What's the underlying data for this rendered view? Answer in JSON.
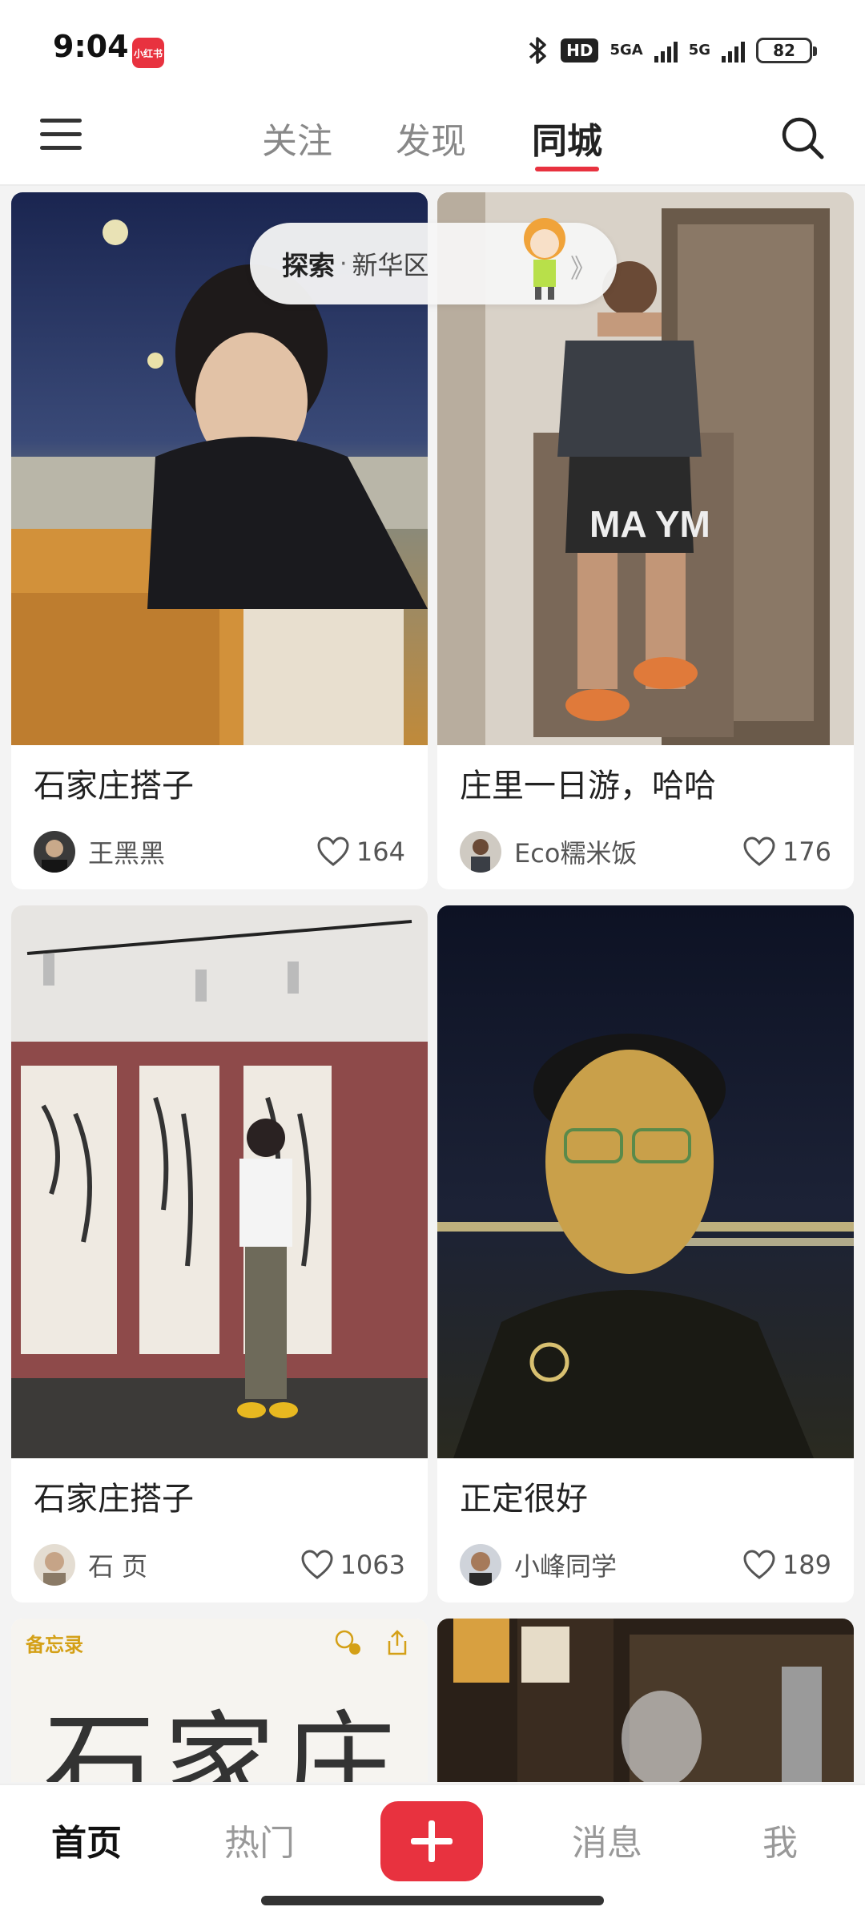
{
  "status_bar": {
    "time": "9:04",
    "app_icon_text": "小红书",
    "hd_label": "HD",
    "network_1": "5GA",
    "network_2": "5G",
    "battery": "82"
  },
  "top_nav": {
    "tabs": [
      {
        "label": "关注",
        "active": false
      },
      {
        "label": "发现",
        "active": false
      },
      {
        "label": "同城",
        "active": true
      }
    ]
  },
  "explore_pill": {
    "label": "探索",
    "dot": "·",
    "location": "新华区",
    "arrow": "》"
  },
  "feed": {
    "cards": [
      {
        "title": "石家庄搭子",
        "author": "王黑黑",
        "likes": "164"
      },
      {
        "title": "庄里一日游，哈哈",
        "author": "Eco糯米饭",
        "likes": "176"
      },
      {
        "title": "石家庄搭子",
        "author": "石 页",
        "likes": "1063"
      },
      {
        "title": "正定很好",
        "author": "小峰同学",
        "likes": "189"
      }
    ],
    "memo_card": {
      "back_label": "备忘录",
      "handwriting": "石家庄"
    }
  },
  "bottom_nav": {
    "items": [
      {
        "label": "首页",
        "active": true
      },
      {
        "label": "热门",
        "active": false
      },
      {
        "label": "消息",
        "active": false
      },
      {
        "label": "我",
        "active": false
      }
    ]
  },
  "colors": {
    "accent": "#e8323f",
    "background": "#f3f3f3"
  }
}
